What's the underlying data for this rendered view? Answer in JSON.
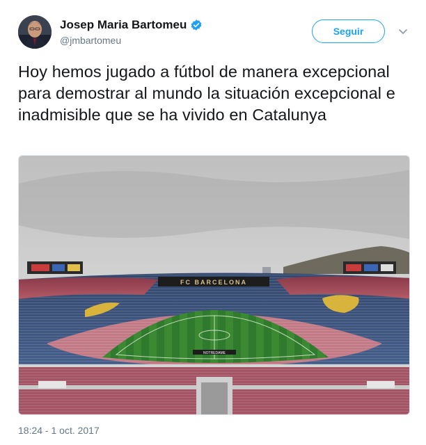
{
  "author": {
    "display_name": "Josep Maria Bartomeu",
    "handle": "@jmbartomeu",
    "verified": true
  },
  "follow_button": {
    "label": "Seguir"
  },
  "tweet": {
    "text": "Hoy hemos jugado a fútbol de manera excepcional para demostrar al mundo la situación excepcional e inadmisible que se ha vivido en Catalunya",
    "timestamp": "18:24 - 1 oct. 2017"
  },
  "media": {
    "stadium_sign": "FC BARCELONA",
    "pitch_sign": "NOTREDAME"
  },
  "colors": {
    "accent": "#1da1f2",
    "text": "#14171a",
    "secondary": "#657786"
  }
}
